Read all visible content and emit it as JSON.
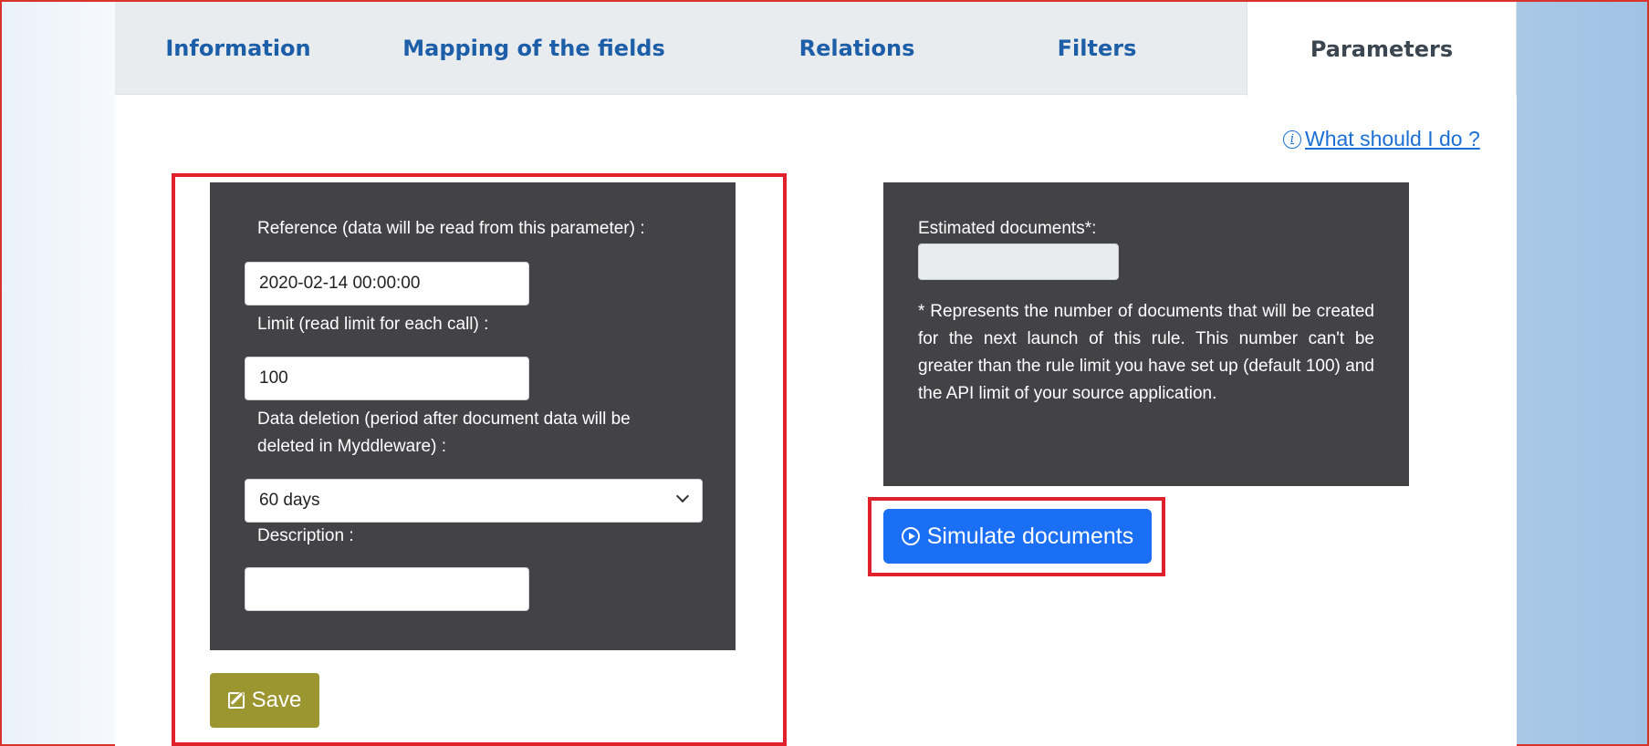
{
  "tabs": [
    {
      "label": "Information"
    },
    {
      "label": "Mapping of the fields"
    },
    {
      "label": "Relations"
    },
    {
      "label": "Filters"
    },
    {
      "label": "Parameters",
      "active": true
    }
  ],
  "help_link": {
    "label": "What should I do ?",
    "icon": "info-icon"
  },
  "params": {
    "reference_label": "Reference (data will be read from this parameter) :",
    "reference_value": "2020-02-14 00:00:00",
    "limit_label": "Limit (read limit for each call) :",
    "limit_value": "100",
    "deletion_label_line1": "Data deletion (period after document data will be",
    "deletion_label_line2": "deleted in Myddleware) :",
    "deletion_value": "60 days",
    "description_label": "Description :",
    "description_value": ""
  },
  "save_button": {
    "label": "Save",
    "icon": "edit-icon"
  },
  "estimate": {
    "label": "Estimated documents*:",
    "value": "",
    "note": "* Represents the number of documents that will be created for the next launch of this rule. This number can't be greater than the rule limit you have set up (default 100) and the API limit of your source application."
  },
  "simulate_button": {
    "label": "Simulate documents",
    "icon": "play-circle-icon"
  },
  "colors": {
    "tab_text": "#1d5ea8",
    "panel_bg": "#434345",
    "save_bg": "#9b9630",
    "simulate_bg": "#1a6ff5",
    "highlight": "#e0202a"
  }
}
